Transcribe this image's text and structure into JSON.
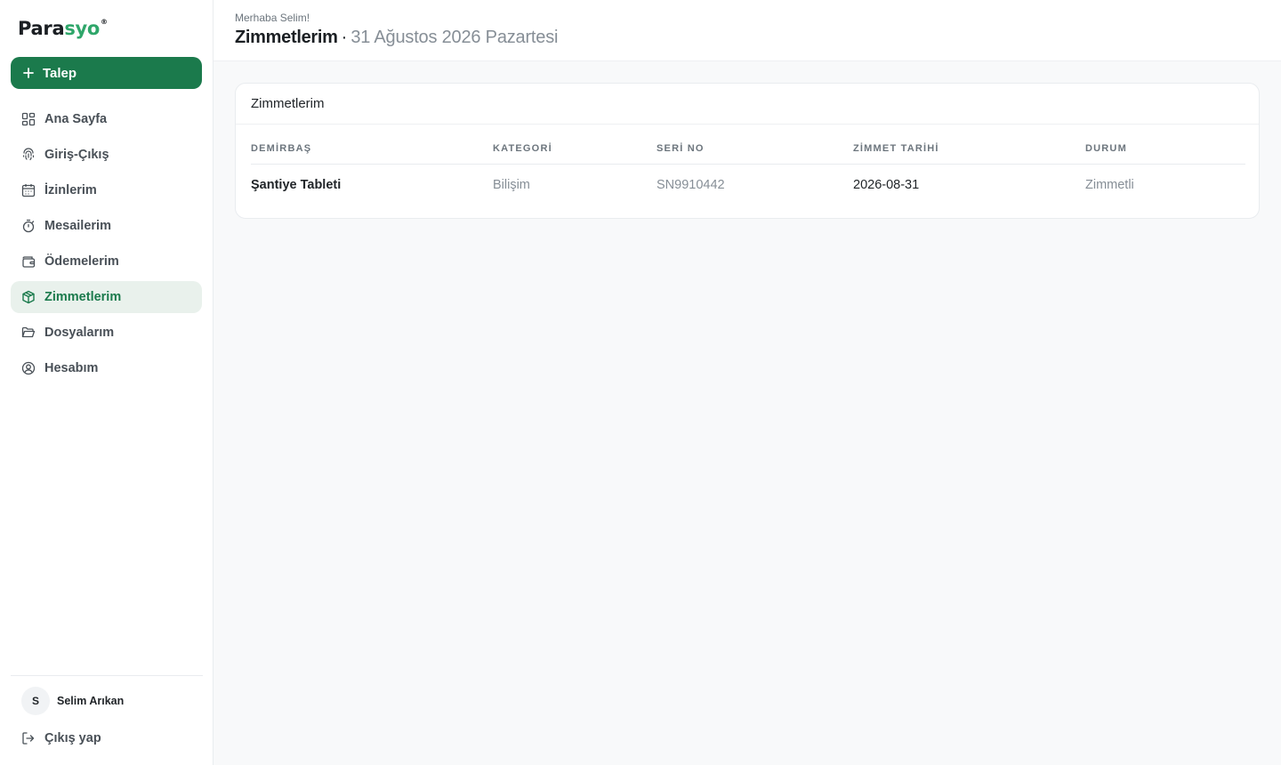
{
  "brand": {
    "name_part1": "Para",
    "name_part2": "syo",
    "registered": "®",
    "accent": "#1b7a4c"
  },
  "sidebar": {
    "new_button": {
      "label": "Talep",
      "icon": "plus-icon"
    },
    "items": [
      {
        "label": "Ana Sayfa",
        "icon": "dashboard-icon",
        "active": false
      },
      {
        "label": "Giriş-Çıkış",
        "icon": "fingerprint-icon",
        "active": false
      },
      {
        "label": "İzinlerim",
        "icon": "calendar-icon",
        "active": false
      },
      {
        "label": "Mesailerim",
        "icon": "stopwatch-icon",
        "active": false
      },
      {
        "label": "Ödemelerim",
        "icon": "wallet-icon",
        "active": false
      },
      {
        "label": "Zimmetlerim",
        "icon": "package-icon",
        "active": true
      },
      {
        "label": "Dosyalarım",
        "icon": "folder-icon",
        "active": false
      },
      {
        "label": "Hesabım",
        "icon": "user-circle-icon",
        "active": false
      }
    ],
    "user": {
      "initial": "S",
      "name": "Selim Arıkan"
    },
    "logout": {
      "label": "Çıkış yap",
      "icon": "logout-icon"
    }
  },
  "header": {
    "greeting": "Merhaba Selim!",
    "title": "Zimmetlerim",
    "separator": "·",
    "date": "31 Ağustos 2026 Pazartesi"
  },
  "card": {
    "title": "Zimmetlerim",
    "columns": [
      "DEMİRBAŞ",
      "KATEGORİ",
      "SERİ NO",
      "ZİMMET TARİHİ",
      "DURUM"
    ],
    "rows": [
      [
        "Şantiye Tableti",
        "Bilişim",
        "SN9910442",
        "2026-08-31",
        "Zimmetli"
      ]
    ]
  }
}
